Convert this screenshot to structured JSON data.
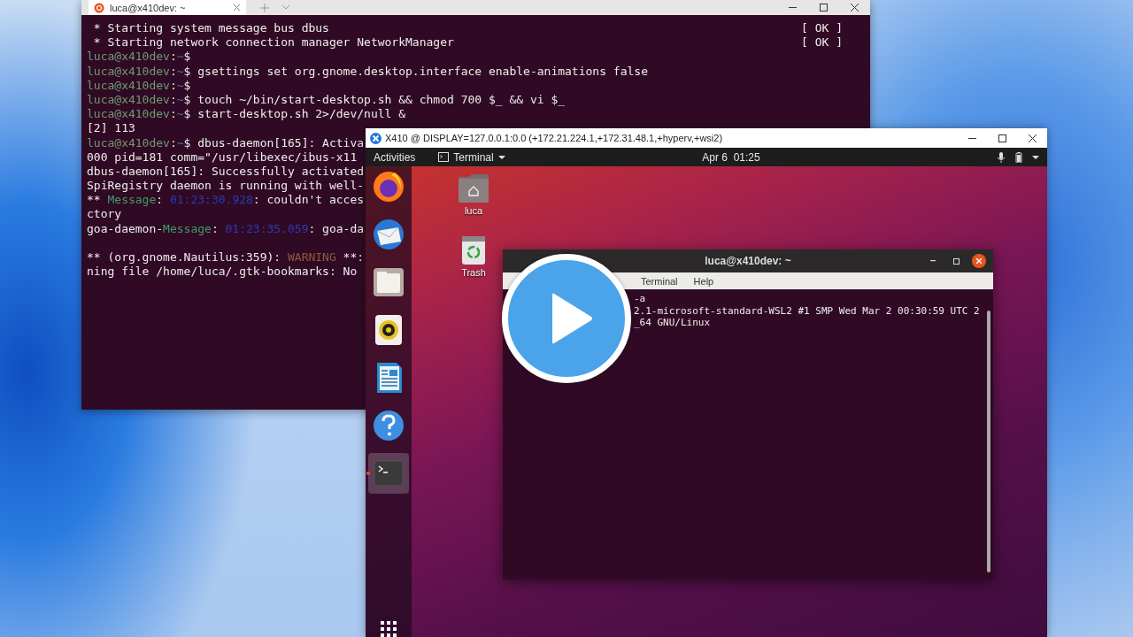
{
  "terminal_window": {
    "tab_title": "luca@x410dev: ~",
    "lines": [
      {
        "kind": "text",
        "segments": [
          {
            "kind": "plain",
            "text": " * Starting system message bus dbus"
          }
        ],
        "status": "[ OK ]"
      },
      {
        "kind": "text",
        "segments": [
          {
            "kind": "plain",
            "text": " * Starting network connection manager NetworkManager"
          }
        ],
        "status": "[ OK ]"
      },
      {
        "kind": "text",
        "segments": [
          {
            "kind": "user",
            "text": "luca@x410dev"
          },
          {
            "kind": "plain",
            "text": ":"
          },
          {
            "kind": "path",
            "text": "~"
          },
          {
            "kind": "plain",
            "text": "$"
          }
        ]
      },
      {
        "kind": "text",
        "segments": [
          {
            "kind": "user",
            "text": "luca@x410dev"
          },
          {
            "kind": "plain",
            "text": ":"
          },
          {
            "kind": "path",
            "text": "~"
          },
          {
            "kind": "plain",
            "text": "$ gsettings set org.gnome.desktop.interface enable-animations false"
          }
        ]
      },
      {
        "kind": "text",
        "segments": [
          {
            "kind": "user",
            "text": "luca@x410dev"
          },
          {
            "kind": "plain",
            "text": ":"
          },
          {
            "kind": "path",
            "text": "~"
          },
          {
            "kind": "plain",
            "text": "$"
          }
        ]
      },
      {
        "kind": "text",
        "segments": [
          {
            "kind": "user",
            "text": "luca@x410dev"
          },
          {
            "kind": "plain",
            "text": ":"
          },
          {
            "kind": "path",
            "text": "~"
          },
          {
            "kind": "plain",
            "text": "$ touch ~/bin/start-desktop.sh && chmod 700 $_ && vi $_"
          }
        ]
      },
      {
        "kind": "text",
        "segments": [
          {
            "kind": "user",
            "text": "luca@x410dev"
          },
          {
            "kind": "plain",
            "text": ":"
          },
          {
            "kind": "path",
            "text": "~"
          },
          {
            "kind": "plain",
            "text": "$ start-desktop.sh 2>/dev/null &"
          }
        ]
      },
      {
        "kind": "text",
        "segments": [
          {
            "kind": "plain",
            "text": "[2] 113"
          }
        ]
      },
      {
        "kind": "text",
        "segments": [
          {
            "kind": "user",
            "text": "luca@x410dev"
          },
          {
            "kind": "plain",
            "text": ":"
          },
          {
            "kind": "path",
            "text": "~"
          },
          {
            "kind": "plain",
            "text": "$ dbus-daemon[165]: Activa"
          }
        ]
      },
      {
        "kind": "text",
        "segments": [
          {
            "kind": "plain",
            "text": "000 pid=181 comm=\"/usr/libexec/ibus-x11"
          }
        ]
      },
      {
        "kind": "text",
        "segments": [
          {
            "kind": "plain",
            "text": "dbus-daemon[165]: Successfully activated"
          }
        ]
      },
      {
        "kind": "text",
        "segments": [
          {
            "kind": "plain",
            "text": "SpiRegistry daemon is running with well-"
          }
        ]
      },
      {
        "kind": "text",
        "segments": [
          {
            "kind": "plain",
            "text": "** "
          },
          {
            "kind": "message",
            "text": "Message"
          },
          {
            "kind": "plain",
            "text": ": "
          },
          {
            "kind": "timestamp",
            "text": "01:23:30.928"
          },
          {
            "kind": "plain",
            "text": ": couldn't acces"
          }
        ]
      },
      {
        "kind": "text",
        "segments": [
          {
            "kind": "plain",
            "text": "ctory"
          }
        ]
      },
      {
        "kind": "text",
        "segments": [
          {
            "kind": "plain",
            "text": "goa-daemon-"
          },
          {
            "kind": "message",
            "text": "Message"
          },
          {
            "kind": "plain",
            "text": ": "
          },
          {
            "kind": "timestamp",
            "text": "01:23:35.059"
          },
          {
            "kind": "plain",
            "text": ": goa-da"
          }
        ]
      },
      {
        "kind": "blank"
      },
      {
        "kind": "text",
        "segments": [
          {
            "kind": "plain",
            "text": "** (org.gnome.Nautilus:359): "
          },
          {
            "kind": "warning",
            "text": "WARNING"
          },
          {
            "kind": "plain",
            "text": " **:"
          }
        ]
      },
      {
        "kind": "text",
        "segments": [
          {
            "kind": "plain",
            "text": "ning file /home/luca/.gtk-bookmarks: No"
          }
        ]
      }
    ]
  },
  "x410_window": {
    "title": "X410 @ DISPLAY=127.0.0.1:0.0 (+172.21.224.1,+172.31.48.1,+hyperv,+wsi2)",
    "top_bar": {
      "activities": "Activities",
      "app_menu": "Terminal",
      "clock": "Apr 6  01:25"
    },
    "dock": [
      {
        "kind": "browser",
        "active": false
      },
      {
        "kind": "mail",
        "active": false
      },
      {
        "kind": "files",
        "active": false
      },
      {
        "kind": "music",
        "active": false
      },
      {
        "kind": "writer",
        "active": false
      },
      {
        "kind": "help",
        "active": false
      },
      {
        "kind": "terminal",
        "active": true
      }
    ],
    "desktop_icons": [
      {
        "kind": "home",
        "label": "luca"
      },
      {
        "kind": "trash",
        "label": "Trash"
      }
    ],
    "terminal": {
      "title": "luca@x410dev: ~",
      "menu": [
        "Terminal",
        "Help"
      ],
      "lines": [
        "-a",
        "2.1-microsoft-standard-WSL2 #1 SMP Wed Mar 2 00:30:59 UTC 2",
        "_64 GNU/Linux"
      ]
    }
  }
}
